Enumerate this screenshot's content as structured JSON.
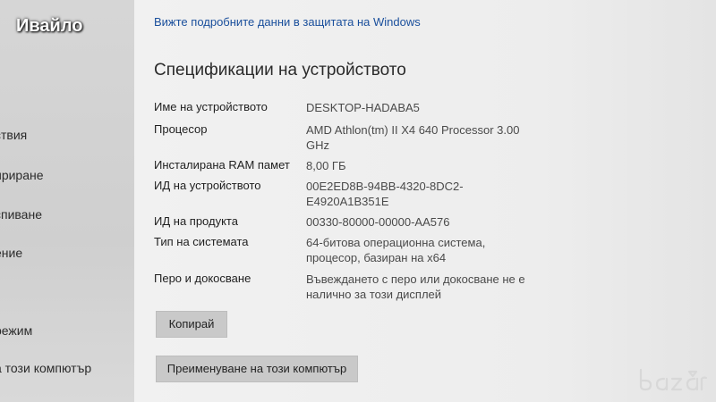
{
  "watermark": {
    "user_name": "Ивайло"
  },
  "sidebar": {
    "items": [
      {
        "label": "ствия"
      },
      {
        "label": "ириране"
      },
      {
        "label": "спиване"
      },
      {
        "label": "ение"
      },
      {
        "label": "режим"
      },
      {
        "label": "а този компютър"
      }
    ]
  },
  "main": {
    "windows_link": "Вижте подробните данни в защитата на Windows",
    "section_title": "Спецификации на устройството",
    "specs": [
      {
        "label": "Име на устройството",
        "value": "DESKTOP-HADABA5"
      },
      {
        "label": "Процесор",
        "value": "AMD Athlon(tm) II X4 640 Processor   3.00 GHz"
      },
      {
        "label": "Инсталирана RAM памет",
        "value": "8,00 ГБ"
      },
      {
        "label": "ИД на устройството",
        "value": "00E2ED8B-94BB-4320-8DC2-E4920A1B351E"
      },
      {
        "label": "ИД на продукта",
        "value": "00330-80000-00000-AA576"
      },
      {
        "label": "Тип на системата",
        "value": "64-битова операционна система, процесор, базиран на x64"
      },
      {
        "label": "Перо и докосване",
        "value": "Въвеждането с перо или докосване не е налично за този дисплей"
      }
    ],
    "copy_button": "Копирай",
    "rename_button": "Преименуване на този компютър"
  },
  "logo_name": "bazar-logo"
}
